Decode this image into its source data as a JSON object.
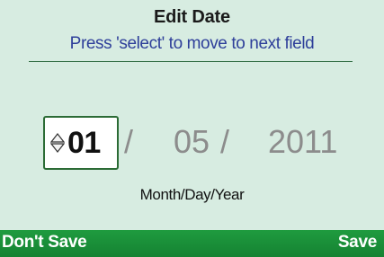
{
  "screen": {
    "title": "Edit Date",
    "instruction": "Press 'select' to move to next field"
  },
  "date": {
    "month": "01",
    "day": "05",
    "year": "2011",
    "separator": "/",
    "format_label": "Month/Day/Year",
    "active_field": "month"
  },
  "softkeys": {
    "left": "Don't Save",
    "right": "Save"
  },
  "icons": {
    "stepper": "up-down-arrows-icon"
  },
  "colors": {
    "background": "#d7ece1",
    "instruction_text": "#2e3f9a",
    "softkey_bar": "#1a8f38",
    "inactive_field_text": "#8c8c8c",
    "active_field_border": "#2b6b35"
  }
}
